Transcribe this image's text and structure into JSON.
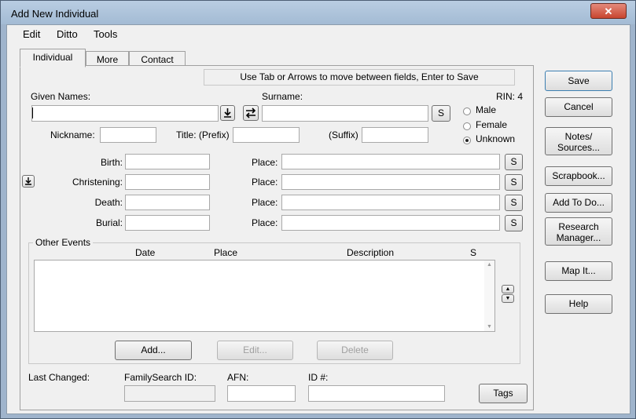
{
  "window": {
    "title": "Add New Individual",
    "close_symbol": "✕"
  },
  "menu": [
    {
      "label": "Edit"
    },
    {
      "label": "Ditto"
    },
    {
      "label": "Tools"
    }
  ],
  "tabs": [
    {
      "label": "Individual"
    },
    {
      "label": "More"
    },
    {
      "label": "Contact"
    }
  ],
  "hint": "Use Tab or Arrows to move between fields, Enter to Save",
  "rin": "RIN: 4",
  "fields": {
    "given_names": {
      "label": "Given Names:",
      "value": ""
    },
    "surname": {
      "label": "Surname:",
      "value": ""
    },
    "nickname": {
      "label": "Nickname:",
      "value": ""
    },
    "title_prefix": {
      "label": "Title: (Prefix)",
      "value": ""
    },
    "suffix": {
      "label": "(Suffix)",
      "value": ""
    }
  },
  "sex": {
    "options": [
      {
        "label": "Male"
      },
      {
        "label": "Female"
      },
      {
        "label": "Unknown"
      }
    ],
    "selected": "Unknown"
  },
  "events": [
    {
      "label": "Birth:",
      "place_label": "Place:",
      "s_label": "S"
    },
    {
      "label": "Christening:",
      "place_label": "Place:",
      "s_label": "S"
    },
    {
      "label": "Death:",
      "place_label": "Place:",
      "s_label": "S"
    },
    {
      "label": "Burial:",
      "place_label": "Place:",
      "s_label": "S"
    }
  ],
  "surname_s_label": "S",
  "other_events": {
    "legend": "Other Events",
    "columns": {
      "date": "Date",
      "place": "Place",
      "description": "Description",
      "s": "S"
    },
    "add": "Add...",
    "edit": "Edit...",
    "delete": "Delete"
  },
  "footer": {
    "last_changed": "Last Changed:",
    "familysearch_id": "FamilySearch ID:",
    "afn": "AFN:",
    "id": "ID #:",
    "tags": "Tags"
  },
  "side_buttons": {
    "save": "Save",
    "cancel": "Cancel",
    "notes_line1": "Notes/",
    "notes_line2": "Sources...",
    "scrapbook": "Scrapbook...",
    "add_todo": "Add To Do...",
    "research_line1": "Research",
    "research_line2": "Manager...",
    "map_it": "Map It...",
    "help": "Help"
  }
}
